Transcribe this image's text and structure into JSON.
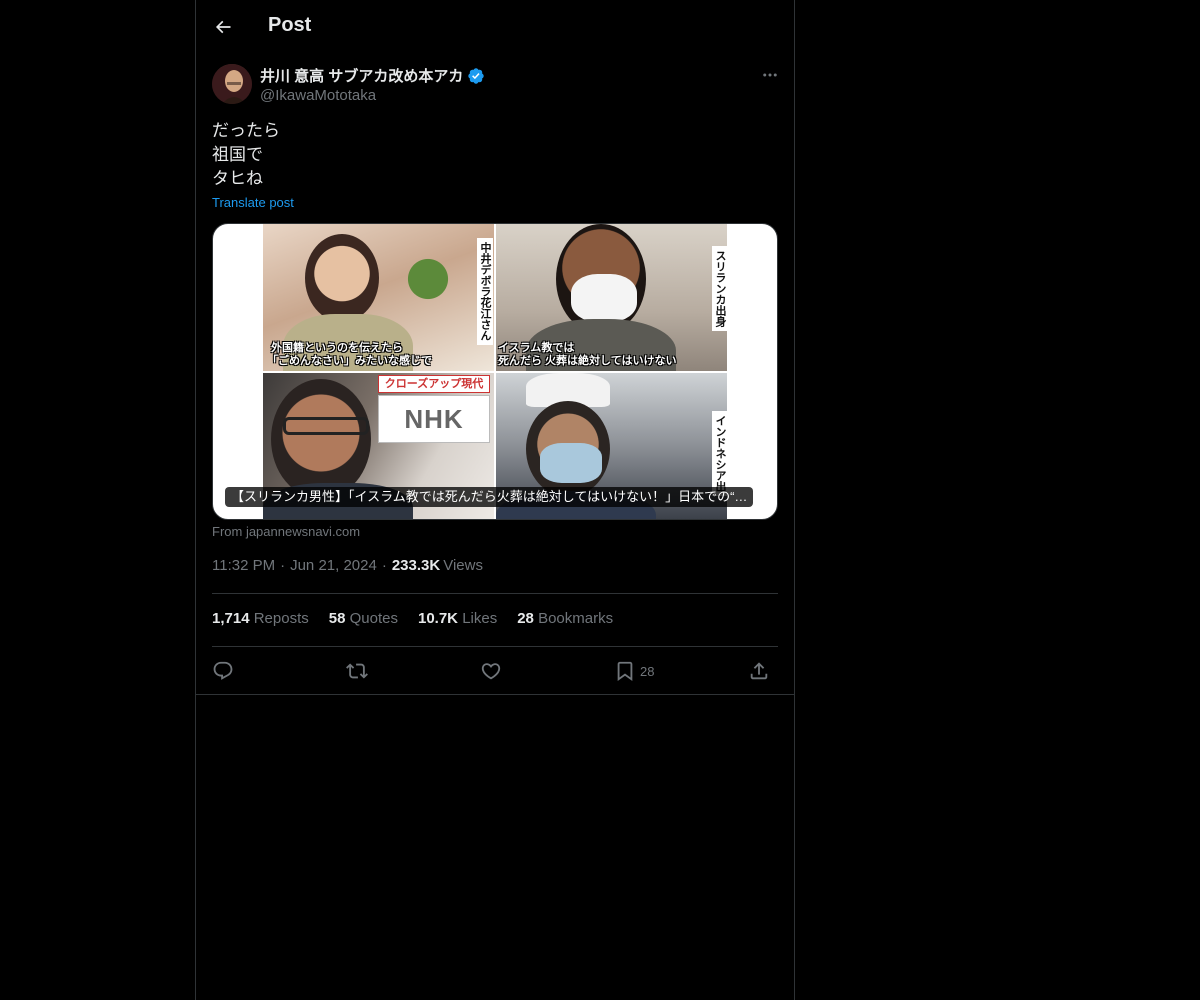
{
  "header": {
    "title": "Post"
  },
  "author": {
    "display_name": "井川 意高 サブアカ改め本アカ",
    "handle": "@IkawaMototaka",
    "verified": true
  },
  "post": {
    "lines": [
      "だったら",
      "祖国で",
      "タヒね"
    ],
    "translate_label": "Translate post"
  },
  "card": {
    "caption": "【スリランカ男性】「イスラム教では死んだら火葬は絶対してはいけない！」日本での“…",
    "source": "From japannewsnavi.com",
    "panels": {
      "p1_vertical_caption": "中井デボラ花江さん",
      "p1_subtitle_line1": "外国籍というのを伝えたら",
      "p1_subtitle_line2": "「ごめんなさい」みたいな感じで",
      "p2_vertical_caption": "スリランカ出身",
      "p2_subtitle_line1": "イスラム教では",
      "p2_subtitle_line2": "死んだら 火葬は絶対してはいけない",
      "p3_banner": "クローズアップ現代",
      "p3_logo": "NHK",
      "p4_vertical_caption": "インドネシア出"
    }
  },
  "meta": {
    "time": "11:32 PM",
    "dot1": "·",
    "date": "Jun 21, 2024",
    "dot2": "·",
    "views_count": "233.3K",
    "views_label": "Views"
  },
  "stats": {
    "reposts_count": "1,714",
    "reposts_label": "Reposts",
    "quotes_count": "58",
    "quotes_label": "Quotes",
    "likes_count": "10.7K",
    "likes_label": "Likes",
    "bookmarks_count": "28",
    "bookmarks_label": "Bookmarks"
  },
  "actions": {
    "reply_icon": "reply-icon",
    "repost_icon": "repost-icon",
    "like_icon": "heart-icon",
    "bookmark_icon": "bookmark-icon",
    "bookmark_count": "28",
    "share_icon": "share-icon"
  },
  "colors": {
    "background": "#000000",
    "accent": "#1d9bf0",
    "text": "#e7e9ea",
    "muted": "#71767b",
    "border": "#2f3336"
  }
}
